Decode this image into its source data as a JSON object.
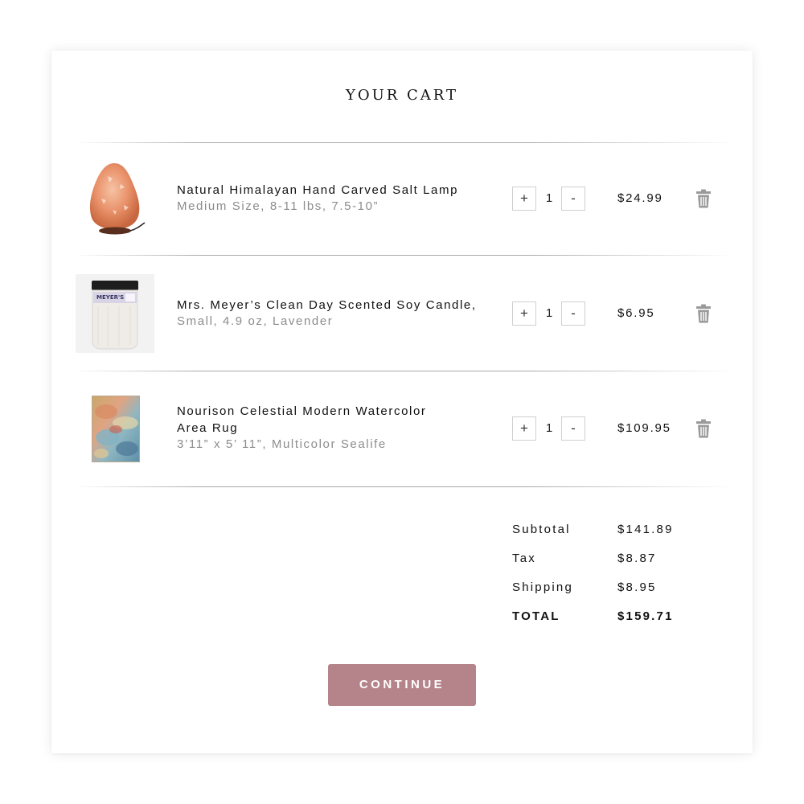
{
  "cart": {
    "title": "YOUR CART",
    "items": [
      {
        "name": "Natural Himalayan Hand Carved Salt Lamp",
        "description": "Medium Size, 8-11 lbs, 7.5-10”",
        "quantity": "1",
        "price": "$24.99",
        "plus_label": "+",
        "minus_label": "-"
      },
      {
        "name": "Mrs. Meyer’s Clean Day Scented Soy Candle,",
        "description": "Small, 4.9 oz, Lavender",
        "quantity": "1",
        "price": "$6.95",
        "plus_label": "+",
        "minus_label": "-"
      },
      {
        "name_line1": "Nourison Celestial Modern Watercolor",
        "name_line2": "Area Rug",
        "description": "3’11” x 5’ 11”, Multicolor Sealife",
        "quantity": "1",
        "price": "$109.95",
        "plus_label": "+",
        "minus_label": "-"
      }
    ],
    "summary": {
      "subtotal_label": "Subtotal",
      "subtotal_value": "$141.89",
      "tax_label": "Tax",
      "tax_value": "$8.87",
      "shipping_label": "Shipping",
      "shipping_value": "$8.95",
      "total_label": "TOTAL",
      "total_value": "$159.71"
    },
    "continue_label": "CONTINUE",
    "candle_label_text": "MEYER'S"
  },
  "colors": {
    "accent": "#b5838a",
    "muted_text": "#8c8c8c",
    "icon_gray": "#9a9a9a"
  },
  "icons": {
    "delete": "trash-icon"
  }
}
